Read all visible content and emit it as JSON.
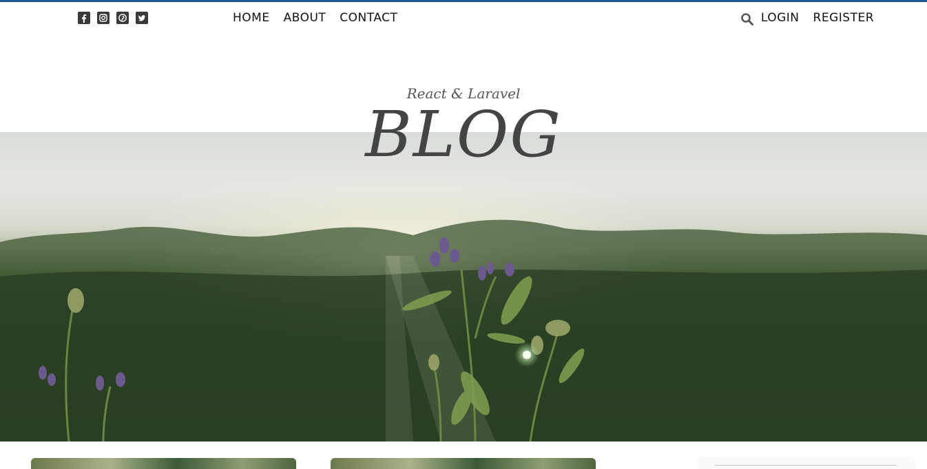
{
  "nav": {
    "socials": [
      {
        "icon": "facebook-icon"
      },
      {
        "icon": "instagram-icon"
      },
      {
        "icon": "pinterest-icon"
      },
      {
        "icon": "twitter-icon"
      }
    ],
    "links": [
      "HOME",
      "ABOUT",
      "CONTACT"
    ],
    "login": "LOGIN",
    "register": "REGISTER",
    "search_icon": "search-icon"
  },
  "hero": {
    "subtitle": "React & Laravel",
    "title": "BLOG"
  },
  "colors": {
    "accent_line": "#1f5b9a",
    "text": "#444444"
  }
}
